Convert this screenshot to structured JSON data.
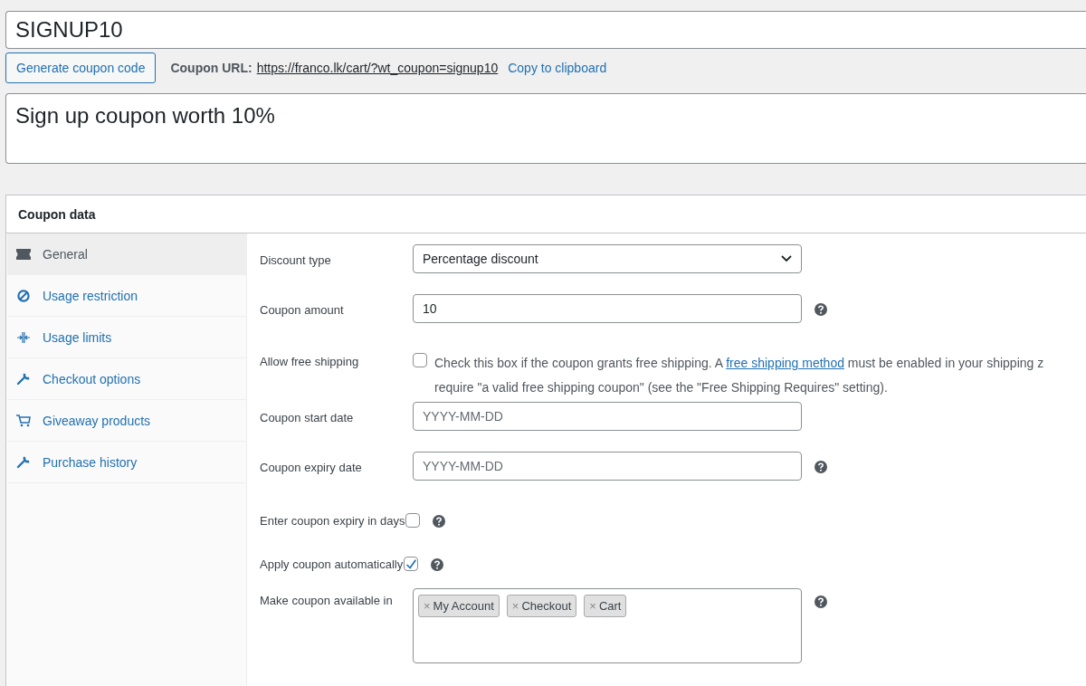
{
  "title_field": {
    "value": "SIGNUP10"
  },
  "generate_button": "Generate coupon code",
  "coupon_url": {
    "label": "Coupon URL:",
    "url": "https://franco.lk/cart/?wt_coupon=signup10",
    "copy": "Copy to clipboard"
  },
  "description_field": {
    "value": "Sign up coupon worth 10%"
  },
  "panel": {
    "title": "Coupon data",
    "tabs": [
      {
        "label": "General",
        "selected": true
      },
      {
        "label": "Usage restriction",
        "selected": false
      },
      {
        "label": "Usage limits",
        "selected": false
      },
      {
        "label": "Checkout options",
        "selected": false
      },
      {
        "label": "Giveaway products",
        "selected": false
      },
      {
        "label": "Purchase history",
        "selected": false
      }
    ],
    "fields": [
      {
        "kind": "select",
        "label": "Discount type",
        "value": "Percentage discount",
        "help": false
      },
      {
        "kind": "text",
        "label": "Coupon amount",
        "value": "10",
        "help": true
      },
      {
        "kind": "shipping",
        "label": "Allow free shipping",
        "checked": false,
        "before": "Check this box if the coupon grants free shipping. A ",
        "link": "free shipping method",
        "after": " must be enabled in your shipping z",
        "line2": "require \"a valid free shipping coupon\" (see the \"Free Shipping Requires\" setting)."
      },
      {
        "kind": "text",
        "label": "Coupon start date",
        "placeholder": "YYYY-MM-DD",
        "help": false
      },
      {
        "kind": "text",
        "label": "Coupon expiry date",
        "placeholder": "YYYY-MM-DD",
        "help": true
      },
      {
        "kind": "checkbox",
        "label": "Enter coupon expiry in days",
        "checked": false,
        "help": true
      },
      {
        "kind": "checkbox",
        "label": "Apply coupon automatically",
        "checked": true,
        "help": true
      },
      {
        "kind": "tags",
        "label": "Make coupon available in",
        "tags": [
          "My Account",
          "Checkout",
          "Cart"
        ],
        "remove": "×",
        "help": true
      }
    ]
  }
}
